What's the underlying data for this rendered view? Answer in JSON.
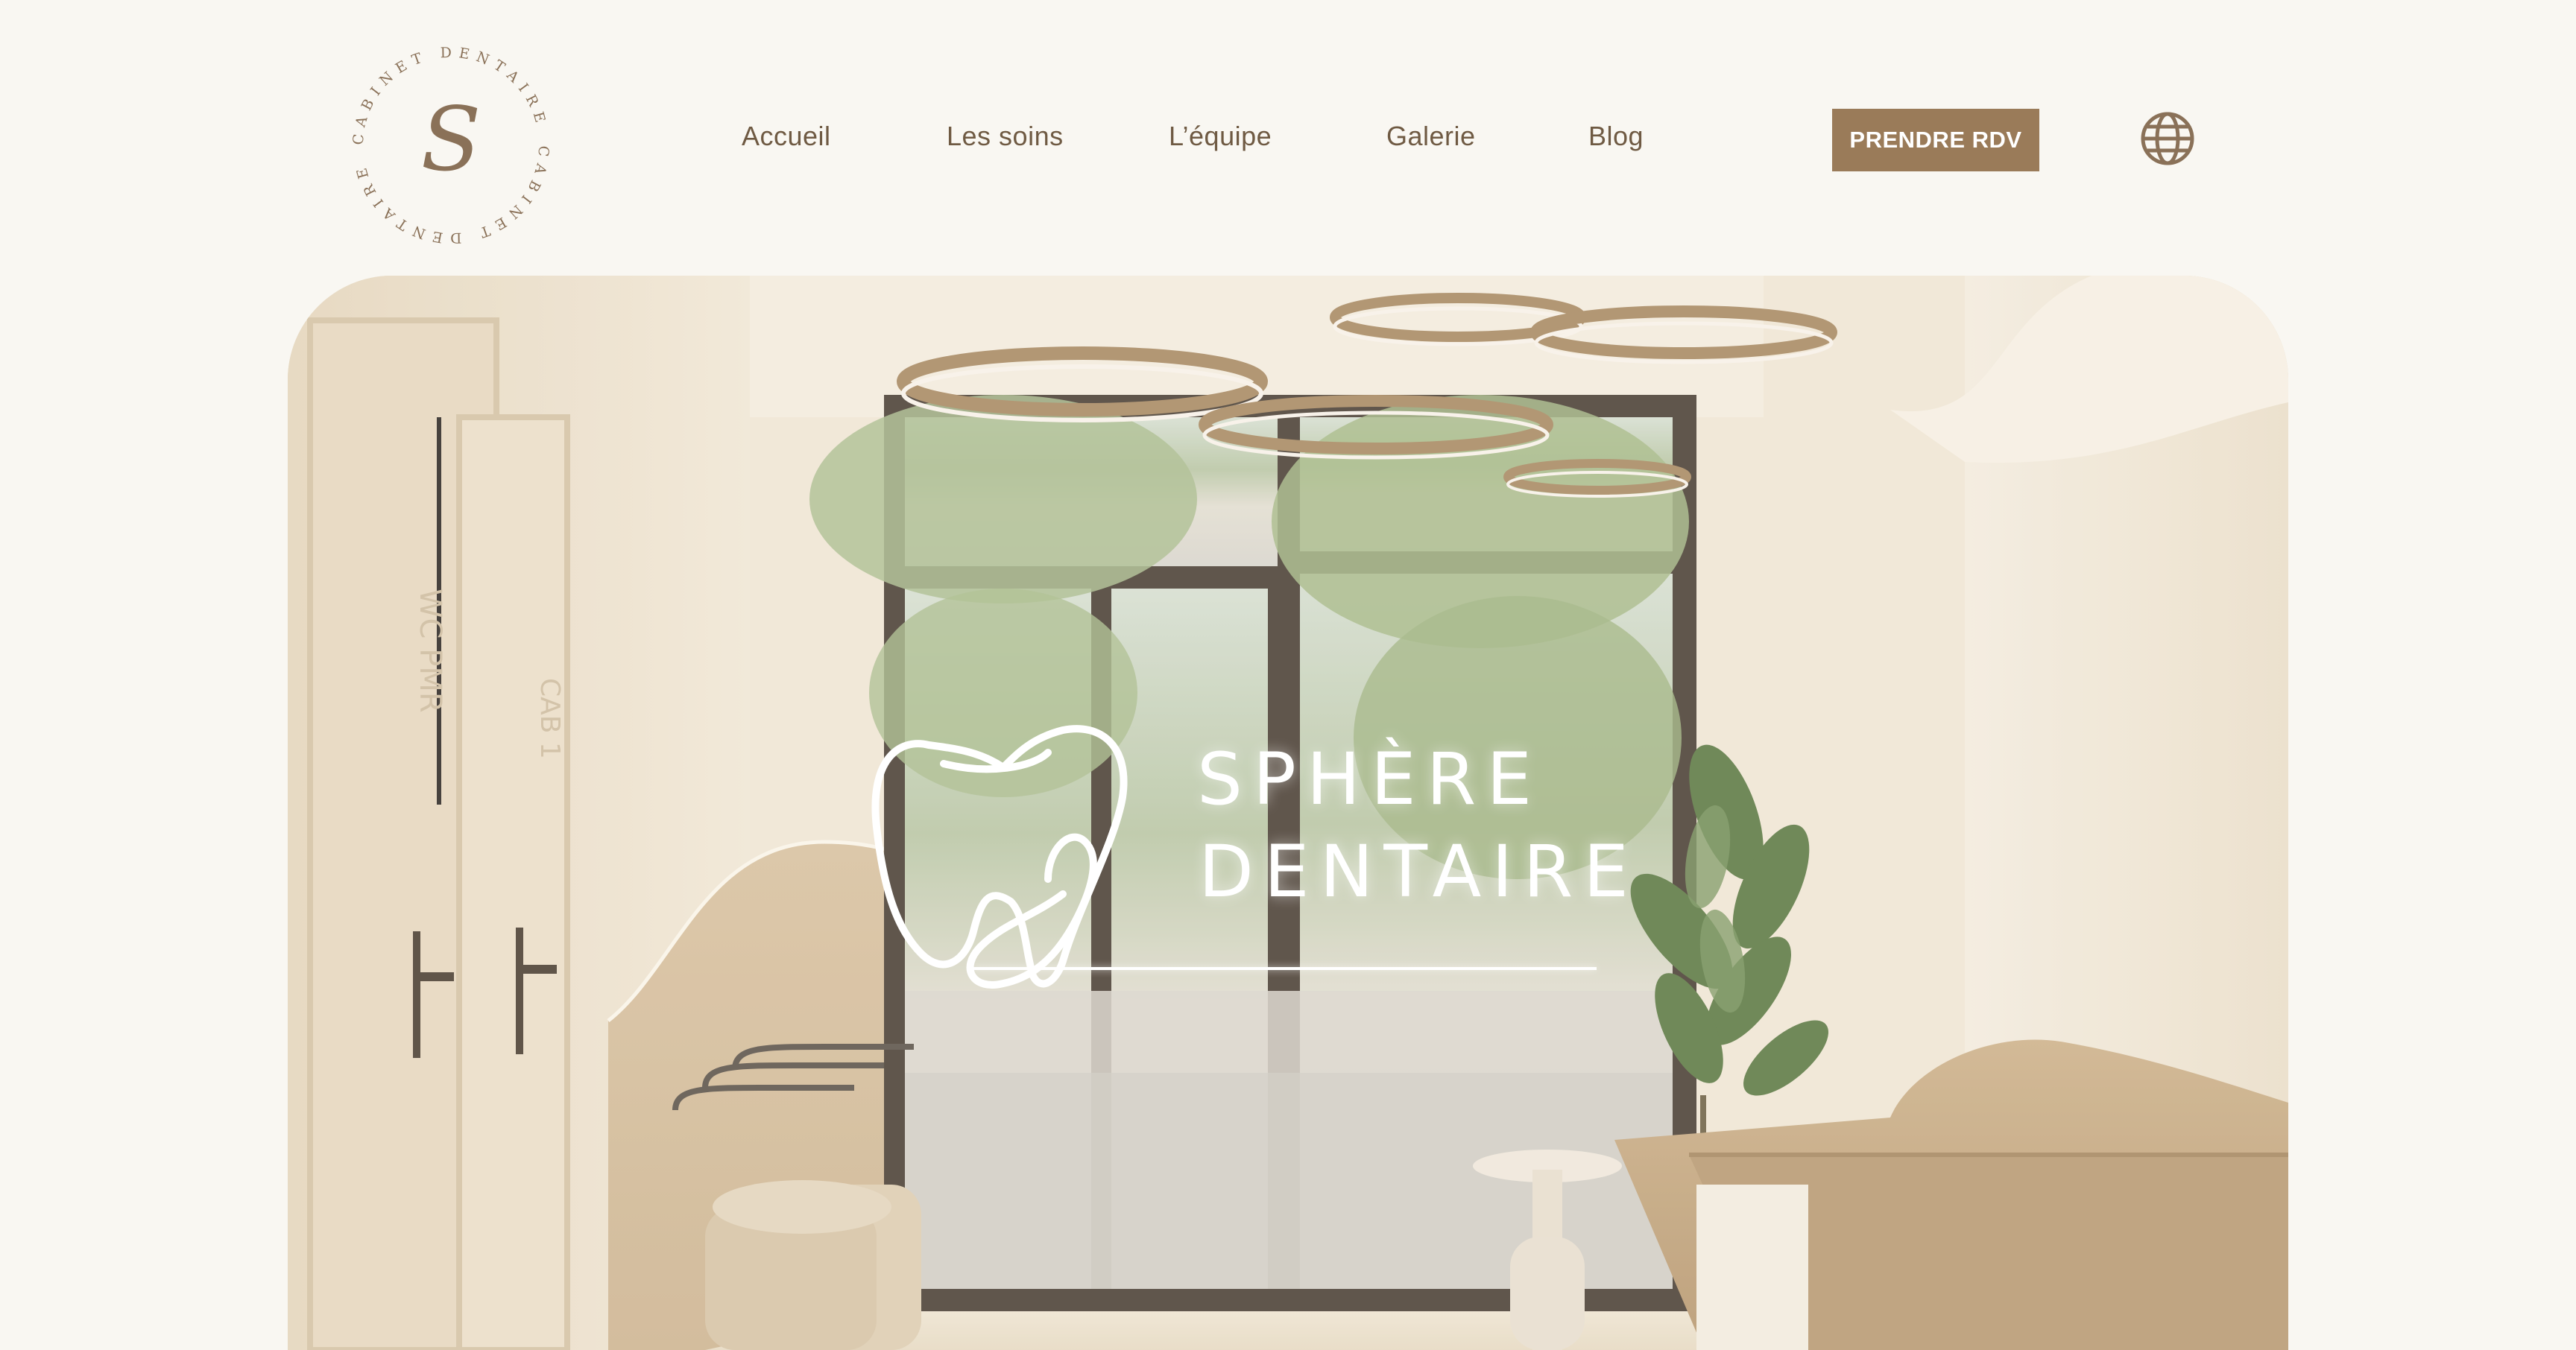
{
  "header": {
    "logo": {
      "ring_text": "CABINET DENTAIRE",
      "monogram": "S"
    },
    "nav": [
      {
        "label": "Accueil"
      },
      {
        "label": "Les soins"
      },
      {
        "label": "L’équipe"
      },
      {
        "label": "Galerie"
      },
      {
        "label": "Blog"
      }
    ],
    "cta_label": "PRENDRE RDV",
    "language_icon": "globe-icon"
  },
  "hero": {
    "brand_line1": "SPHÈRE",
    "brand_line2": "DENTAIRE",
    "door_signs": [
      "WC PMR",
      "CAB 1"
    ]
  },
  "colors": {
    "background": "#f9f7f2",
    "accent": "#9a7b59",
    "nav_text": "#6f5a43"
  }
}
